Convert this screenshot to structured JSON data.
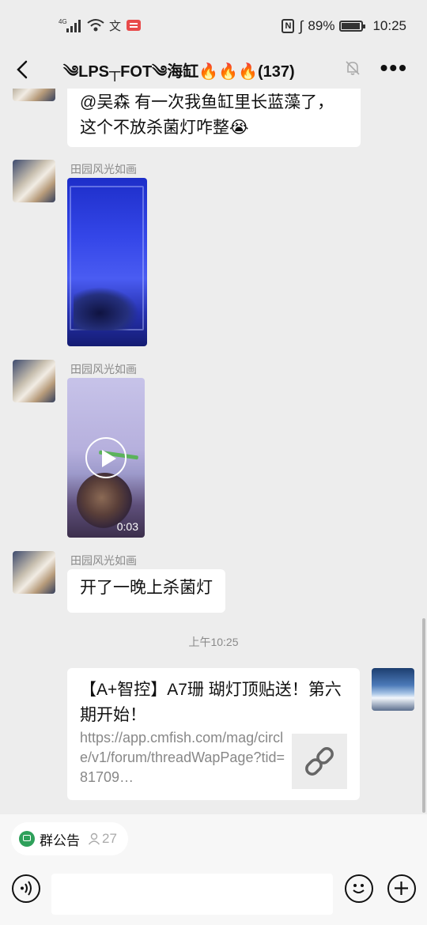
{
  "status_bar": {
    "network": "4G",
    "battery_percent": "89%",
    "time": "10:25"
  },
  "header": {
    "title": "༄LPS┬FOT༄海缸🔥🔥🔥(137)",
    "back_icon": "chevron-left-icon",
    "mute_icon": "bell-off-icon",
    "more_icon": "more-icon"
  },
  "messages": {
    "m1": {
      "text": "@吴森 有一次我鱼缸里长蓝藻了，这个不放杀菌灯咋整😭"
    },
    "m2": {
      "sender": "田园风光如画",
      "type": "image"
    },
    "m3": {
      "sender": "田园风光如画",
      "type": "video",
      "duration": "0:03"
    },
    "m4": {
      "sender": "田园风光如画",
      "text": "开了一晚上杀菌灯"
    },
    "timestamp": "上午10:25",
    "m5": {
      "title": "【A+智控】A7珊 瑚灯顶贴送！第六期开始！",
      "url": "https://app.cmfish.com/mag/circle/v1/forum/threadWapPage?tid=81709…"
    }
  },
  "bottom": {
    "notice_label": "群公告",
    "member_count": "27"
  }
}
